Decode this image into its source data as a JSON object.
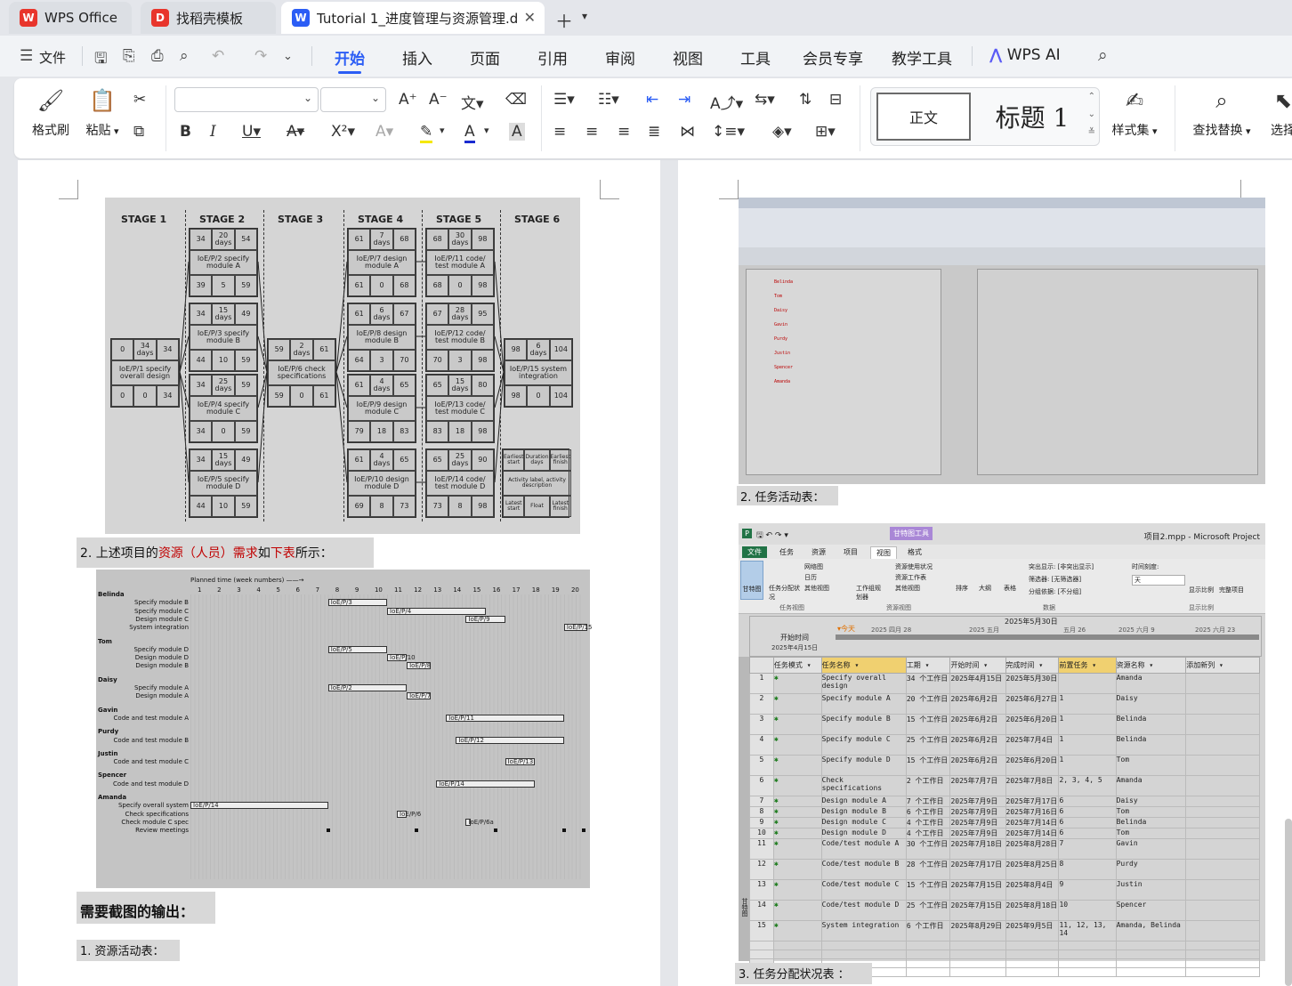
{
  "tabs": [
    {
      "label": "WPS Office",
      "logo": "W",
      "color": "#e8352c"
    },
    {
      "label": "找稻壳模板",
      "logo": "D",
      "color": "#e8352c"
    },
    {
      "label": "Tutorial 1_进度管理与资源管理.d",
      "logo": "W",
      "color": "#2b5df5"
    }
  ],
  "menu": {
    "file": "文件",
    "items": [
      "开始",
      "插入",
      "页面",
      "引用",
      "审阅",
      "视图",
      "工具",
      "会员专享",
      "教学工具"
    ],
    "active": "开始",
    "ai": "WPS AI"
  },
  "ribbon": {
    "format_painter": "格式刷",
    "paste": "粘贴",
    "style_normal": "正文",
    "style_heading": "标题 1",
    "style_set": "样式集",
    "find_replace": "查找替换",
    "select": "选择"
  },
  "doc": {
    "stages": [
      "STAGE 1",
      "STAGE 2",
      "STAGE 3",
      "STAGE 4",
      "STAGE 5",
      "STAGE 6"
    ],
    "para1_a": "2. 上述项目的",
    "para1_b": "资源（人员）需求",
    "para1_c": "如",
    "para1_d": "下表",
    "para1_e": "所示：",
    "heading_output": "需要截图的输出：",
    "item1": "1. 资源活动表：",
    "item2": "2. 任务活动表：",
    "item3": "3. 任务分配状况表 ："
  },
  "network": [
    {
      "label": "IoE/P/1 specify overall design",
      "es": "0",
      "dur": "34",
      "ef": "34",
      "ls": "0",
      "fl": "0",
      "lf": "34"
    },
    {
      "label": "IoE/P/2 specify module A",
      "es": "34",
      "dur": "20",
      "ef": "54",
      "ls": "39",
      "fl": "5",
      "lf": "59"
    },
    {
      "label": "IoE/P/3 specify module B",
      "es": "34",
      "dur": "15",
      "ef": "49",
      "ls": "44",
      "fl": "10",
      "lf": "59"
    },
    {
      "label": "IoE/P/4 specify module C",
      "es": "34",
      "dur": "25",
      "ef": "59",
      "ls": "34",
      "fl": "0",
      "lf": "59"
    },
    {
      "label": "IoE/P/5 specify module D",
      "es": "34",
      "dur": "15",
      "ef": "49",
      "ls": "44",
      "fl": "10",
      "lf": "59"
    },
    {
      "label": "IoE/P/6 check specifications",
      "es": "59",
      "dur": "2",
      "ef": "61",
      "ls": "59",
      "fl": "0",
      "lf": "61"
    },
    {
      "label": "IoE/P/7 design module A",
      "es": "61",
      "dur": "7",
      "ef": "68",
      "ls": "61",
      "fl": "0",
      "lf": "68"
    },
    {
      "label": "IoE/P/8 design module B",
      "es": "61",
      "dur": "6",
      "ef": "67",
      "ls": "64",
      "fl": "3",
      "lf": "70"
    },
    {
      "label": "IoE/P/9 design module C",
      "es": "61",
      "dur": "4",
      "ef": "65",
      "ls": "79",
      "fl": "18",
      "lf": "83"
    },
    {
      "label": "IoE/P/10 design module D",
      "es": "61",
      "dur": "4",
      "ef": "65",
      "ls": "69",
      "fl": "8",
      "lf": "73"
    },
    {
      "label": "IoE/P/11 code/ test module A",
      "es": "68",
      "dur": "30",
      "ef": "98",
      "ls": "68",
      "fl": "0",
      "lf": "98"
    },
    {
      "label": "IoE/P/12 code/ test module B",
      "es": "67",
      "dur": "28",
      "ef": "95",
      "ls": "70",
      "fl": "3",
      "lf": "98"
    },
    {
      "label": "IoE/P/13 code/ test module C",
      "es": "65",
      "dur": "15",
      "ef": "80",
      "ls": "83",
      "fl": "18",
      "lf": "98"
    },
    {
      "label": "IoE/P/14 code/ test module D",
      "es": "65",
      "dur": "25",
      "ef": "90",
      "ls": "73",
      "fl": "8",
      "lf": "98"
    },
    {
      "label": "IoE/P/15 system integration",
      "es": "98",
      "dur": "6",
      "ef": "104",
      "ls": "98",
      "fl": "0",
      "lf": "104"
    }
  ],
  "legend_box": {
    "es": "Earliest start",
    "dur": "Duration",
    "ef": "Earliest finish",
    "desc": "Activity label, activity description",
    "ls": "Latest start",
    "fl": "Float",
    "lf": "Latest finish"
  },
  "gantt": {
    "title": "Planned time (week numbers)",
    "weeks": [
      "1",
      "2",
      "3",
      "4",
      "5",
      "6",
      "7",
      "8",
      "9",
      "10",
      "11",
      "12",
      "13",
      "14",
      "15",
      "16",
      "17",
      "18",
      "19",
      "20"
    ],
    "rows": [
      {
        "label": "Belinda",
        "bold": true
      },
      {
        "label": "Specify module B"
      },
      {
        "label": "Specify module C"
      },
      {
        "label": "Design module C"
      },
      {
        "label": "System integration"
      },
      {
        "label": "Tom",
        "bold": true
      },
      {
        "label": "Specify module D"
      },
      {
        "label": "Design module D"
      },
      {
        "label": "Design module B"
      },
      {
        "label": "Daisy",
        "bold": true
      },
      {
        "label": "Specify module A"
      },
      {
        "label": "Design module A"
      },
      {
        "label": "Gavin",
        "bold": true
      },
      {
        "label": "Code and test module A"
      },
      {
        "label": "Purdy",
        "bold": true
      },
      {
        "label": "Code and test module B"
      },
      {
        "label": "Justin",
        "bold": true
      },
      {
        "label": "Code and test module C"
      },
      {
        "label": "Spencer",
        "bold": true
      },
      {
        "label": "Code and test module D"
      },
      {
        "label": "Amanda",
        "bold": true
      },
      {
        "label": "Specify overall system"
      },
      {
        "label": "Check specifications"
      },
      {
        "label": "Check module C spec"
      },
      {
        "label": "Review meetings"
      }
    ],
    "bars": [
      {
        "label": "IoE/P/3",
        "row": 1,
        "start": 7,
        "len": 3
      },
      {
        "label": "IoE/P/4",
        "row": 2,
        "start": 10,
        "len": 5
      },
      {
        "label": "IoE/P/9",
        "row": 3,
        "start": 14,
        "len": 2
      },
      {
        "label": "IoE/P/15",
        "row": 4,
        "start": 19,
        "len": 1.2
      },
      {
        "label": "IoE/P/5",
        "row": 6,
        "start": 7,
        "len": 3
      },
      {
        "label": "IoE/P/10",
        "row": 7,
        "start": 10,
        "len": 1
      },
      {
        "label": "IoE/P/8",
        "row": 8,
        "start": 11,
        "len": 1.2
      },
      {
        "label": "IoE/P/2",
        "row": 10,
        "start": 7,
        "len": 4
      },
      {
        "label": "IoE/P/7",
        "row": 11,
        "start": 11,
        "len": 1.2
      },
      {
        "label": "IoE/P/11",
        "row": 13,
        "start": 13,
        "len": 6
      },
      {
        "label": "IoE/P/12",
        "row": 15,
        "start": 13.5,
        "len": 5.5
      },
      {
        "label": "IoE/P/13",
        "row": 17,
        "start": 16,
        "len": 1.5
      },
      {
        "label": "IoE/P/14",
        "row": 19,
        "start": 12.5,
        "len": 5
      },
      {
        "label": "IoE/P/14",
        "row": 21,
        "start": 0,
        "len": 7
      },
      {
        "label": "IoE/P/6",
        "row": 22,
        "start": 10.5,
        "len": 0.5
      },
      {
        "label": "IoE/P/6a",
        "row": 23,
        "start": 14,
        "len": 0.2
      }
    ]
  },
  "project": {
    "title": "项目2.mpp - Microsoft Project",
    "context_tab": "甘特图工具",
    "tabs": [
      "文件",
      "任务",
      "资源",
      "项目",
      "视图",
      "格式"
    ],
    "active_tab": "视图",
    "timeline_start_label": "开始时间",
    "timeline_start_date": "2025年4月15日",
    "today": "今天",
    "timeline_date": "2025年5月30日",
    "months": [
      "2025 四月 28",
      "2025 五月",
      "五月 26",
      "2025 六月 9",
      "2025 六月 23"
    ],
    "side_label": "甘特图",
    "ribbon_groups": [
      "任务视图",
      "资源视图",
      "数据",
      "显示比例"
    ],
    "ribbon_items": {
      "gantt": "甘特图",
      "task_usage": "任务分配状况",
      "network": "网络图",
      "calendar": "日历",
      "other": "其他视图",
      "team_planner": "工作组规划器",
      "res_usage": "资源使用状况",
      "res_sheet": "资源工作表",
      "other_views": "其他视图",
      "sort": "排序",
      "outline": "大纲",
      "tables": "表格",
      "highlight": "突出显示:",
      "highlight_val": "[非突出显示]",
      "filter": "筛选器:",
      "filter_val": "[无筛选器]",
      "group": "分组依据:",
      "group_val": "[不分组]",
      "timescale": "时间刻度:",
      "timescale_val": "天",
      "zoom": "显示比例",
      "whole": "完整项目"
    },
    "headers": [
      "任务模式",
      "任务名称",
      "工期",
      "开始时间",
      "完成时间",
      "前置任务",
      "资源名称",
      "添加新列"
    ],
    "rows": [
      {
        "id": "1",
        "name": "Specify overall design",
        "dur": "34 个工作日",
        "start": "2025年4月15日",
        "finish": "2025年5月30日",
        "pred": "",
        "res": "Amanda"
      },
      {
        "id": "2",
        "name": "Specify module A",
        "dur": "20 个工作日",
        "start": "2025年6月2日",
        "finish": "2025年6月27日",
        "pred": "1",
        "res": "Daisy"
      },
      {
        "id": "3",
        "name": "Specify module B",
        "dur": "15 个工作日",
        "start": "2025年6月2日",
        "finish": "2025年6月20日",
        "pred": "1",
        "res": "Belinda"
      },
      {
        "id": "4",
        "name": "Specify module C",
        "dur": "25 个工作日",
        "start": "2025年6月2日",
        "finish": "2025年7月4日",
        "pred": "1",
        "res": "Belinda"
      },
      {
        "id": "5",
        "name": "Specify module D",
        "dur": "15 个工作日",
        "start": "2025年6月2日",
        "finish": "2025年6月20日",
        "pred": "1",
        "res": "Tom"
      },
      {
        "id": "6",
        "name": "Check specifications",
        "dur": "2 个工作日",
        "start": "2025年7月7日",
        "finish": "2025年7月8日",
        "pred": "2, 3, 4, 5",
        "res": "Amanda"
      },
      {
        "id": "7",
        "name": "Design module A",
        "dur": "7 个工作日",
        "start": "2025年7月9日",
        "finish": "2025年7月17日",
        "pred": "6",
        "res": "Daisy"
      },
      {
        "id": "8",
        "name": "Design module B",
        "dur": "6 个工作日",
        "start": "2025年7月9日",
        "finish": "2025年7月16日",
        "pred": "6",
        "res": "Tom"
      },
      {
        "id": "9",
        "name": "Design module C",
        "dur": "4 个工作日",
        "start": "2025年7月9日",
        "finish": "2025年7月14日",
        "pred": "6",
        "res": "Belinda"
      },
      {
        "id": "10",
        "name": "Design module D",
        "dur": "4 个工作日",
        "start": "2025年7月9日",
        "finish": "2025年7月14日",
        "pred": "6",
        "res": "Tom"
      },
      {
        "id": "11",
        "name": "Code/test module A",
        "dur": "30 个工作日",
        "start": "2025年7月18日",
        "finish": "2025年8月28日",
        "pred": "7",
        "res": "Gavin"
      },
      {
        "id": "12",
        "name": "Code/test module B",
        "dur": "28 个工作日",
        "start": "2025年7月17日",
        "finish": "2025年8月25日",
        "pred": "8",
        "res": "Purdy"
      },
      {
        "id": "13",
        "name": "Code/test module C",
        "dur": "15 个工作日",
        "start": "2025年7月15日",
        "finish": "2025年8月4日",
        "pred": "9",
        "res": "Justin"
      },
      {
        "id": "14",
        "name": "Code/test module D",
        "dur": "25 个工作日",
        "start": "2025年7月15日",
        "finish": "2025年8月18日",
        "pred": "10",
        "res": "Spencer"
      },
      {
        "id": "15",
        "name": "System integration",
        "dur": "6 个工作日",
        "start": "2025年8月29日",
        "finish": "2025年9月5日",
        "pred": "11, 12, 13, 14",
        "res": "Amanda, Belinda"
      }
    ]
  },
  "usage": {
    "people": [
      "Belinda",
      "Tom",
      "Daisy",
      "Gavin",
      "Purdy",
      "Justin",
      "Spencer",
      "Amanda"
    ]
  }
}
